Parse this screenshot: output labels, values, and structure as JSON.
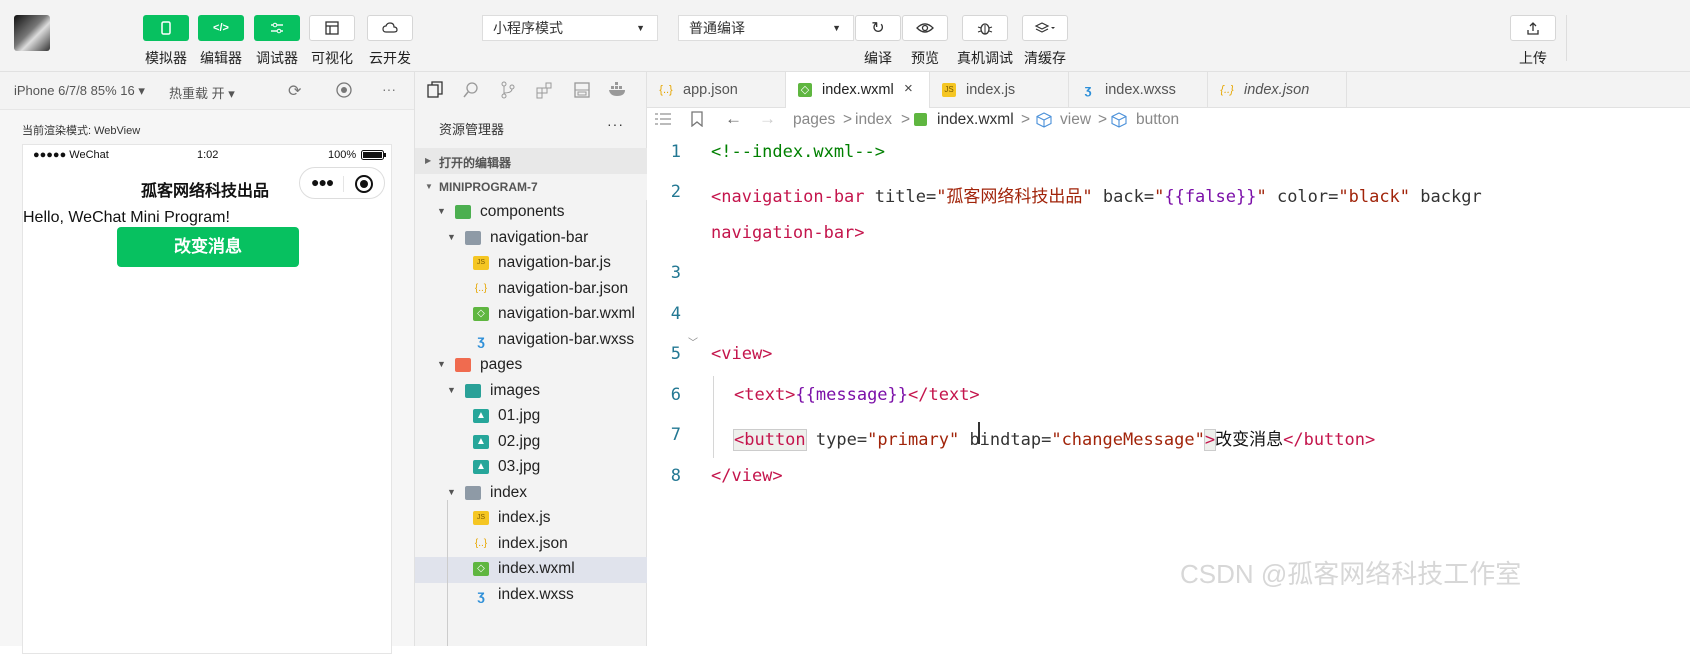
{
  "toolbar": {
    "left_buttons": [
      {
        "label": "模拟器",
        "icon": "phone-icon"
      },
      {
        "label": "编辑器",
        "icon": "code-icon"
      },
      {
        "label": "调试器",
        "icon": "sliders-icon"
      },
      {
        "label": "可视化",
        "icon": "layout-icon"
      },
      {
        "label": "云开发",
        "icon": "cloud-icon"
      }
    ],
    "mode_select": "小程序模式",
    "compile_select": "普通编译",
    "right_buttons": [
      {
        "label": "编译",
        "icon": "refresh-icon"
      },
      {
        "label": "预览",
        "icon": "eye-icon"
      },
      {
        "label": "真机调试",
        "icon": "bug-icon"
      },
      {
        "label": "清缓存",
        "icon": "layers-icon"
      }
    ],
    "upload_label": "上传"
  },
  "simulator": {
    "device": "iPhone 6/7/8 85% 16 ▾",
    "hot_reload": "热重载 开 ▾",
    "more": "···",
    "render_mode": "当前渲染模式: WebView",
    "status_signal": "●●●●● WeChat",
    "status_time": "1:02",
    "status_battery": "100%",
    "nav_title": "孤客网络科技出品",
    "hello_text": "Hello, WeChat Mini Program!",
    "button_label": "改变消息"
  },
  "explorer": {
    "title": "资源管理器",
    "more": "···",
    "open_editors": "打开的编辑器",
    "project": "MINIPROGRAM-7",
    "tree": [
      {
        "name": "components",
        "depth": 1,
        "type": "folder-green",
        "expanded": true
      },
      {
        "name": "navigation-bar",
        "depth": 2,
        "type": "folder",
        "expanded": true
      },
      {
        "name": "navigation-bar.js",
        "depth": 3,
        "type": "js"
      },
      {
        "name": "navigation-bar.json",
        "depth": 3,
        "type": "json"
      },
      {
        "name": "navigation-bar.wxml",
        "depth": 3,
        "type": "wxml"
      },
      {
        "name": "navigation-bar.wxss",
        "depth": 3,
        "type": "wxss"
      },
      {
        "name": "pages",
        "depth": 1,
        "type": "folder-orange",
        "expanded": true
      },
      {
        "name": "images",
        "depth": 2,
        "type": "folder-teal",
        "expanded": true
      },
      {
        "name": "01.jpg",
        "depth": 3,
        "type": "image"
      },
      {
        "name": "02.jpg",
        "depth": 3,
        "type": "image"
      },
      {
        "name": "03.jpg",
        "depth": 3,
        "type": "image"
      },
      {
        "name": "index",
        "depth": 2,
        "type": "folder",
        "expanded": true
      },
      {
        "name": "index.js",
        "depth": 3,
        "type": "js"
      },
      {
        "name": "index.json",
        "depth": 3,
        "type": "json"
      },
      {
        "name": "index.wxml",
        "depth": 3,
        "type": "wxml",
        "selected": true
      },
      {
        "name": "index.wxss",
        "depth": 3,
        "type": "wxss"
      }
    ]
  },
  "tabs": [
    {
      "label": "app.json",
      "icon": "json"
    },
    {
      "label": "index.wxml",
      "icon": "wxml",
      "active": true,
      "close": "×"
    },
    {
      "label": "index.js",
      "icon": "js"
    },
    {
      "label": "index.wxss",
      "icon": "wxss"
    },
    {
      "label": "index.json",
      "icon": "json",
      "italic": true
    }
  ],
  "breadcrumb": {
    "parts": [
      "pages",
      ">",
      "index",
      ">"
    ],
    "file": "index.wxml",
    "sep": ">",
    "view": "view",
    "button": "button"
  },
  "code": {
    "line_numbers": [
      "1",
      "2",
      "3",
      "4",
      "5",
      "6",
      "7",
      "8"
    ],
    "line1": "<!--index.wxml-->",
    "line2_tag": "<navigation-bar",
    "line2_a1": " title=",
    "line2_v1": "\"孤客网络科技出品\"",
    "line2_a2": " back=",
    "line2_v2": "\"{{false}}\"",
    "line2_a3": " color=",
    "line2_v3": "\"black\"",
    "line2_a4": " backgr",
    "line2_wrap": "navigation-bar>",
    "line5": "<view>",
    "line6_open": "<text>",
    "line6_mus": "{{message}}",
    "line6_close": "</text>",
    "line7_open": "<button",
    "line7_a1": " type=",
    "line7_v1": "\"primary\"",
    "line7_a2": " bindtap=",
    "line7_v2": "\"changeMessage\"",
    "line7_gt": ">",
    "line7_text": "改变消息",
    "line7_close": "</button>",
    "line8": "</view>"
  },
  "watermark": "CSDN @孤客网络科技工作室"
}
